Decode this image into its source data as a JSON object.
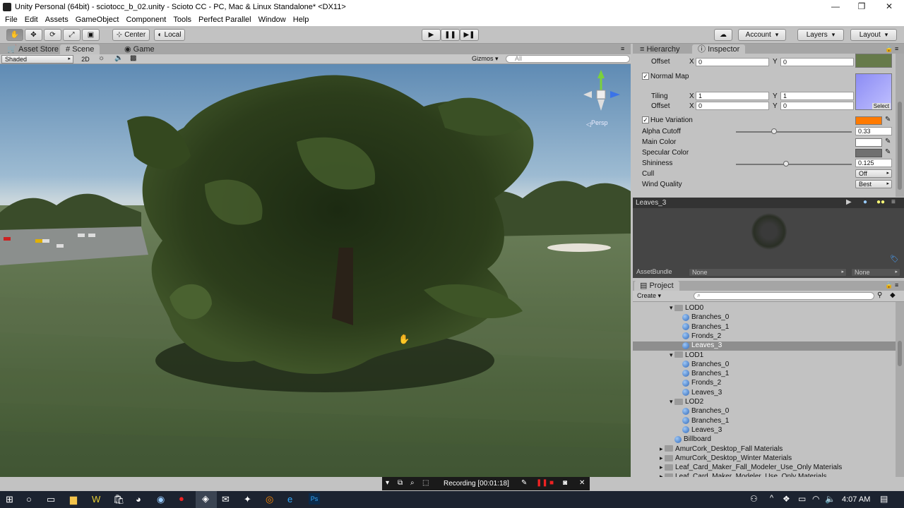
{
  "window": {
    "title": "Unity Personal (64bit) - sciotocc_b_02.unity - Scioto CC - PC, Mac & Linux Standalone* <DX11>"
  },
  "menu": [
    "File",
    "Edit",
    "Assets",
    "GameObject",
    "Component",
    "Tools",
    "Perfect Parallel",
    "Window",
    "Help"
  ],
  "toolbar": {
    "center": "Center",
    "local": "Local",
    "account": "Account",
    "layers": "Layers",
    "layout": "Layout"
  },
  "scene": {
    "tabs": [
      "Asset Store",
      "Scene",
      "Game"
    ],
    "shading": "Shaded",
    "mode2d": "2D",
    "gizmos": "Gizmos",
    "search_placeholder": "All",
    "persp": "Persp"
  },
  "inspector": {
    "tabs": [
      "Hierarchy",
      "Inspector"
    ],
    "offset1": {
      "label": "Offset",
      "x": "0",
      "y": "0"
    },
    "normal_map": "Normal Map",
    "tiling": {
      "label": "Tiling",
      "x": "1",
      "y": "1"
    },
    "offset2": {
      "label": "Offset",
      "x": "0",
      "y": "0"
    },
    "select": "Select",
    "hue_variation": "Hue Variation",
    "alpha_cutoff": {
      "label": "Alpha Cutoff",
      "value": "0.33",
      "fraction": 0.33
    },
    "main_color": "Main Color",
    "specular_color": "Specular Color",
    "shininess": {
      "label": "Shininess",
      "value": "0.125",
      "fraction": 0.43
    },
    "cull": {
      "label": "Cull",
      "value": "Off"
    },
    "wind_quality": {
      "label": "Wind Quality",
      "value": "Best"
    },
    "hue_color": "#ff7a00"
  },
  "preview": {
    "name": "Leaves_3",
    "assetbundle_label": "AssetBundle",
    "assetbundle_value": "None",
    "variant": "None"
  },
  "project": {
    "title": "Project",
    "create": "Create",
    "tree": [
      {
        "label": "LOD0",
        "type": "folder",
        "depth": 0
      },
      {
        "label": "Branches_0",
        "type": "mesh",
        "depth": 1
      },
      {
        "label": "Branches_1",
        "type": "mesh",
        "depth": 1
      },
      {
        "label": "Fronds_2",
        "type": "mesh",
        "depth": 1
      },
      {
        "label": "Leaves_3",
        "type": "mesh",
        "depth": 1,
        "selected": true
      },
      {
        "label": "LOD1",
        "type": "folder",
        "depth": 0
      },
      {
        "label": "Branches_0",
        "type": "mesh",
        "depth": 1
      },
      {
        "label": "Branches_1",
        "type": "mesh",
        "depth": 1
      },
      {
        "label": "Fronds_2",
        "type": "mesh",
        "depth": 1
      },
      {
        "label": "Leaves_3",
        "type": "mesh",
        "depth": 1
      },
      {
        "label": "LOD2",
        "type": "folder",
        "depth": 0
      },
      {
        "label": "Branches_0",
        "type": "mesh",
        "depth": 1
      },
      {
        "label": "Branches_1",
        "type": "mesh",
        "depth": 1
      },
      {
        "label": "Leaves_3",
        "type": "mesh",
        "depth": 1
      },
      {
        "label": "Billboard",
        "type": "mesh",
        "depth": -1
      },
      {
        "label": "AmurCork_Desktop_Fall Materials",
        "type": "folder",
        "depth": -2
      },
      {
        "label": "AmurCork_Desktop_Winter Materials",
        "type": "folder",
        "depth": -2
      },
      {
        "label": "Leaf_Card_Maker_Fall_Modeler_Use_Only Materials",
        "type": "folder",
        "depth": -2
      },
      {
        "label": "Leaf_Card_Maker_Modeler_Use_Only Materials",
        "type": "folder",
        "depth": -2
      }
    ]
  },
  "recording": {
    "label": "Recording [00:01:18]"
  },
  "taskbar": {
    "time": "4:07 AM"
  }
}
